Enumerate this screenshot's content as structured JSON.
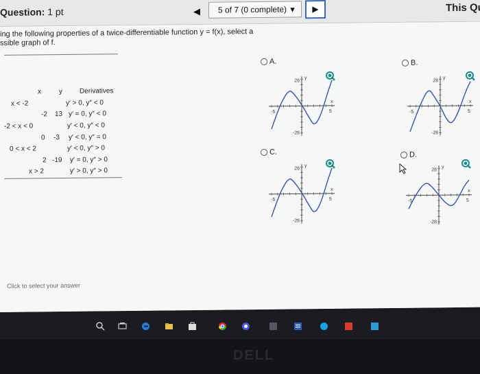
{
  "header": {
    "question_prefix": "Question:",
    "question_points": "1 pt",
    "prev_glyph": "◀",
    "progress": "5 of 7 (0 complete)",
    "dropdown_caret": "▼",
    "next_glyph": "▶",
    "this_question": "This Qu"
  },
  "prompt": {
    "line1": "ing the following properties of a twice-differentiable function y = f(x), select a",
    "line2": "ssible graph of f."
  },
  "table": {
    "headers": {
      "x": "x",
      "y": "y",
      "derivatives": "Derivatives"
    },
    "rows": [
      {
        "x": "x < -2",
        "y": "",
        "d": "y′ > 0, y″ < 0"
      },
      {
        "x": "-2",
        "y": "13",
        "d": "y′ = 0, y″ < 0"
      },
      {
        "x": "-2 < x < 0",
        "y": "",
        "d": "y′ < 0, y″ < 0"
      },
      {
        "x": "0",
        "y": "-3",
        "d": "y′ < 0, y″ = 0"
      },
      {
        "x": "0 < x < 2",
        "y": "",
        "d": "y′ < 0, y″ > 0"
      },
      {
        "x": "2",
        "y": "-19",
        "d": "y′ = 0, y″ > 0"
      },
      {
        "x": "x > 2",
        "y": "",
        "d": "y′ > 0, y″ > 0"
      }
    ]
  },
  "options": [
    {
      "label": "A.",
      "y_top": "28",
      "y_bottom": "-28",
      "x_left": "-5",
      "x_right": "5",
      "x_axis": "x",
      "y_axis": "y"
    },
    {
      "label": "B.",
      "y_top": "28",
      "y_bottom": "-28",
      "x_left": "-5",
      "x_right": "5",
      "x_axis": "x",
      "y_axis": "y"
    },
    {
      "label": "C.",
      "y_top": "28",
      "y_bottom": "-28",
      "x_left": "-5",
      "x_right": "5",
      "x_axis": "x",
      "y_axis": "y"
    },
    {
      "label": "D.",
      "y_top": "28",
      "y_bottom": "-28",
      "x_left": "-5",
      "x_right": "5",
      "x_axis": "x",
      "y_axis": "y"
    }
  ],
  "footer": {
    "click_prompt": "Click to select your answer"
  },
  "taskbar": {
    "icons": [
      "search-icon",
      "task-view-icon",
      "edge-icon",
      "file-explorer-icon",
      "store-icon",
      "chrome-icon",
      "firefox-icon",
      "app-icon",
      "word-icon",
      "skype-icon",
      "pdf-icon",
      "photos-icon"
    ]
  },
  "bezel": {
    "brand": "DELL"
  },
  "colors": {
    "accent": "#3a6ab8",
    "zoom": "#1f8c8c",
    "curve": "#3a52a8"
  }
}
